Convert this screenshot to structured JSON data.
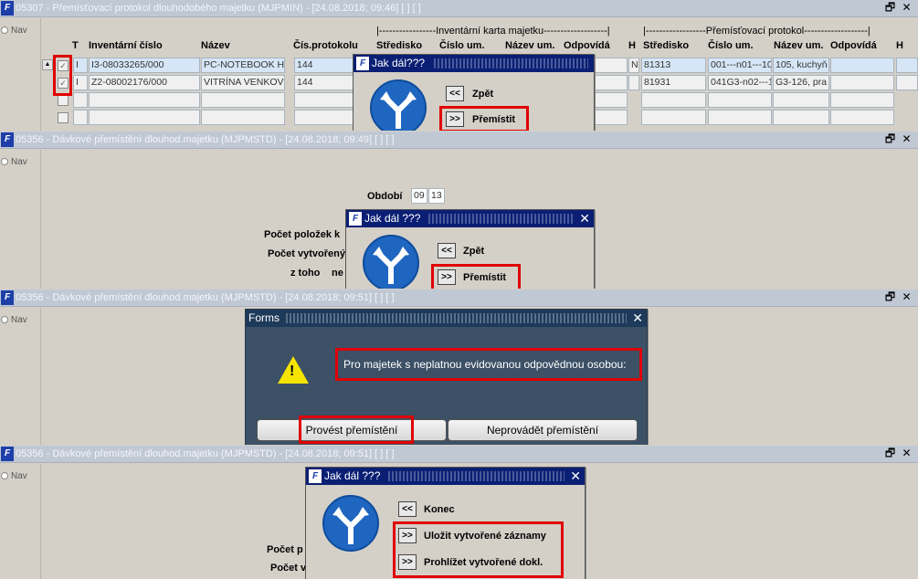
{
  "panel1": {
    "window_title": "05307 - Přemísťovací protokol dlouhodobého majetku (MJPMIN) - [24.08.2018; 09:46]  [ ]  [ ]",
    "nav_label": "Nav",
    "group_left": "|-----------------Inventární karta majetku-------------------|",
    "group_right": "|------------------Přemísťovací protokol-------------------|",
    "headers": {
      "t": "T",
      "inv": "Inventární číslo",
      "nazev": "Název",
      "cis": "Čís.protokolu",
      "stredisko": "Středisko",
      "cislo_um": "Číslo um.",
      "nazev_um": "Název um.",
      "odpovida": "Odpovídá",
      "h": "H",
      "stredisko2": "Středisko",
      "cislo_um2": "Číslo um.",
      "nazev_um2": "Název um.",
      "odpovida2": "Odpovídá",
      "h2": "H"
    },
    "rows": [
      {
        "checked": true,
        "t": "I",
        "inv": "I3-08033265/000",
        "nazev": "PC-NOTEBOOK HP",
        "cis": "144",
        "h": "N",
        "stredisko2": "81313",
        "cislo_um2": "001---n01---10",
        "nazev_um2": "105, kuchyň"
      },
      {
        "checked": true,
        "t": "I",
        "inv": "Z2-08002176/000",
        "nazev": "VITRÍNA VENKOV",
        "cis": "144",
        "h": "",
        "stredisko2": "81931",
        "cislo_um2": "041G3-n02---1",
        "nazev_um2": "G3-126, pra"
      }
    ],
    "dialog": {
      "title": "Jak dál???",
      "back_btn": "<<",
      "back_label": "Zpět",
      "fwd_btn": ">>",
      "fwd_label": "Přemístit"
    }
  },
  "panel2": {
    "window_title": "05356 - Dávkové přemístění dlouhod.majetku (MJPMSTD) - [24.08.2018; 09:49]  [ ]  [ ]",
    "nav_label": "Nav",
    "obdobi_label": "Období",
    "obdobi_month": "09",
    "obdobi_year": "13",
    "pocet_polozek": "Počet položek k",
    "pocet_vytvorenych": "Počet vytvořený",
    "z_toho": "z toho",
    "ne": "ne",
    "dialog": {
      "title": "Jak dál ???",
      "back_btn": "<<",
      "back_label": "Zpět",
      "fwd_btn": ">>",
      "fwd_label": "Přemístit"
    }
  },
  "panel3": {
    "window_title": "05356 - Dávkové přemístění dlouhod.majetku (MJPMSTD) - [24.08.2018; 09:51]  [ ]  [ ]",
    "nav_label": "Nav",
    "dialog": {
      "title": "Forms",
      "message": "Pro majetek s neplatnou evidovanou odpovědnou osobou:",
      "btn_do": "Provést přemístění",
      "btn_dont": "Neprovádět přemístění"
    }
  },
  "panel4": {
    "window_title": "05356 - Dávkové přemístění dlouhod.majetku (MJPMSTD) - [24.08.2018; 09:51]  [ ]  [ ]",
    "nav_label": "Nav",
    "pocet_p": "Počet p",
    "pocet_v": "Počet v",
    "dialog": {
      "title": "Jak dál ???",
      "end_btn": "<<",
      "end_label": "Konec",
      "save_btn": ">>",
      "save_label": "Uložit vytvořené záznamy",
      "view_btn": ">>",
      "view_label": "Prohlížet vytvořené dokl."
    }
  },
  "colors": {
    "accent": "#0a1f74",
    "highlight": "#e00000",
    "sign_blue": "#1f66c0"
  }
}
